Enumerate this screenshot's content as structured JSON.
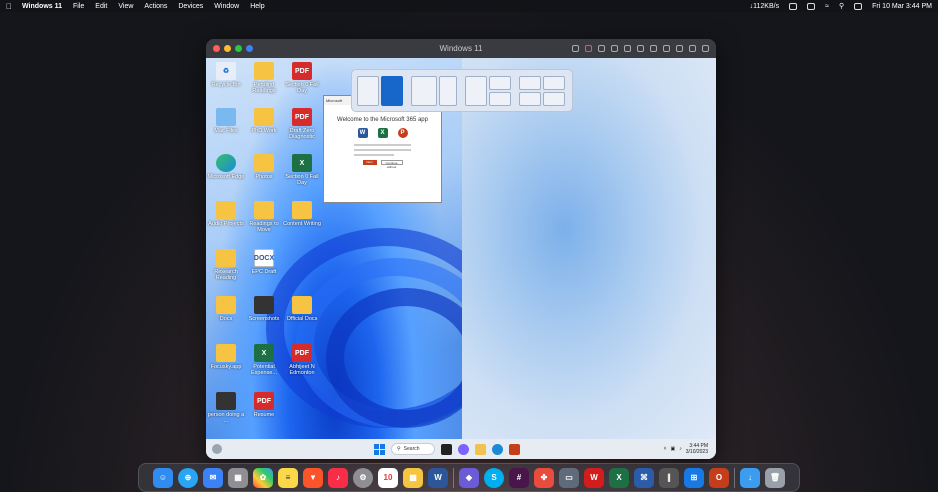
{
  "menubar": {
    "app_name": "Windows 11",
    "items": [
      "File",
      "Edit",
      "View",
      "Actions",
      "Devices",
      "Window",
      "Help"
    ],
    "net_speed": "↓112KB/s",
    "datetime": "Fri 10 Mar  3:44 PM"
  },
  "vm": {
    "title": "Windows 11",
    "desktop_icons": [
      {
        "label": "Recycle Bin",
        "type": "bin"
      },
      {
        "label": "Pending Readings",
        "type": "folder"
      },
      {
        "label": "Section 0 Fall Day",
        "type": "pdf"
      },
      {
        "label": "Mac Files",
        "type": "folder-blue"
      },
      {
        "label": "PhD Work",
        "type": "folder"
      },
      {
        "label": "Draft Zero Diagnostic",
        "type": "pdf"
      },
      {
        "label": "Microsoft Edge",
        "type": "edge"
      },
      {
        "label": "Photos",
        "type": "folder"
      },
      {
        "label": "Section 0 Fall Day",
        "type": "excel"
      },
      {
        "label": "Audio Projects",
        "type": "folder"
      },
      {
        "label": "Readings to Move",
        "type": "folder"
      },
      {
        "label": "Content Writing",
        "type": "folder"
      },
      {
        "label": "Research Reading",
        "type": "folder"
      },
      {
        "label": "EPC Draft",
        "type": "docx"
      },
      {
        "label": "Docs",
        "type": "folder"
      },
      {
        "label": "Screenshots",
        "type": "folder-dark"
      },
      {
        "label": "Official Docs",
        "type": "folder"
      },
      {
        "label": "Focusky.app",
        "type": "folder"
      },
      {
        "label": "Potential Expense...",
        "type": "excel"
      },
      {
        "label": "Abhijeet N Edmonton",
        "type": "pdf"
      },
      {
        "label": "person doing a ...",
        "type": "dark"
      },
      {
        "label": "Resume",
        "type": "pdf"
      }
    ],
    "office_window": {
      "header": "Microsoft",
      "title": "Welcome to the Microsoft 365 app",
      "primary_button": "Next",
      "secondary_button": "Continue without"
    },
    "taskbar": {
      "search_label": "Search",
      "time": "3:44 PM",
      "date": "3/10/2023"
    }
  }
}
